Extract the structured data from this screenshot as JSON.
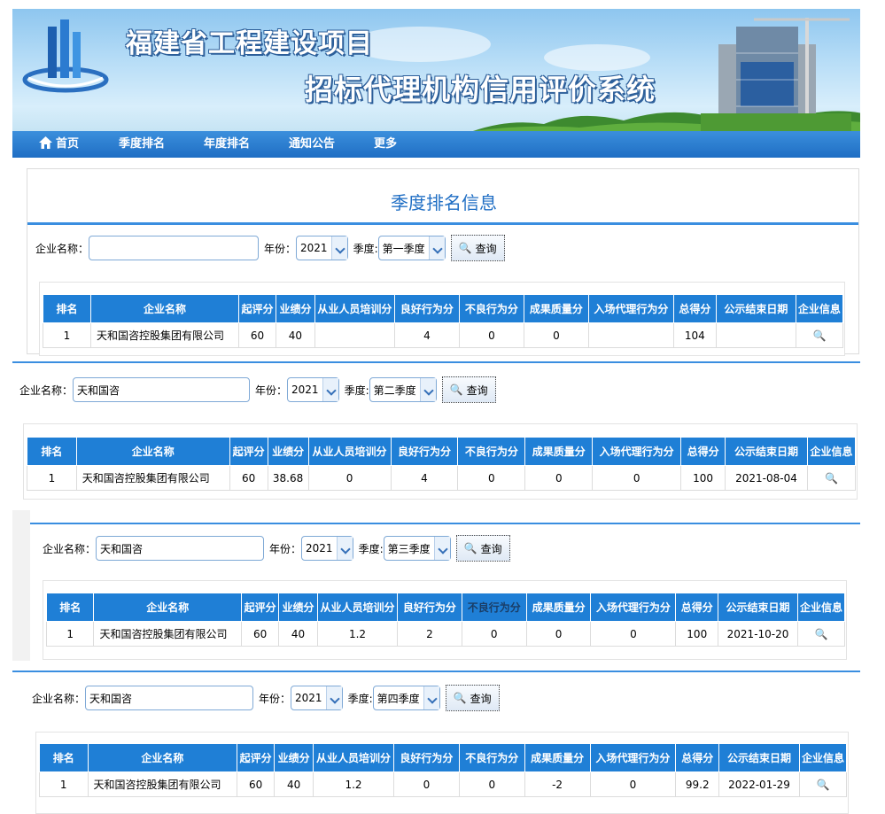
{
  "site": {
    "title_line1": "福建省工程建设项目",
    "title_line2": "招标代理机构信用评价系统"
  },
  "nav": {
    "items": [
      "首页",
      "季度排名",
      "年度排名",
      "通知公告",
      "更多"
    ]
  },
  "page": {
    "title": "季度排名信息"
  },
  "search_labels": {
    "name": "企业名称：",
    "year": "年份：",
    "quarter": "季度:",
    "query_button": "查询"
  },
  "table_headers": [
    "排名",
    "企业名称",
    "起评分",
    "业绩分",
    "从业人员培训分",
    "良好行为分",
    "不良行为分",
    "成果质量分",
    "入场代理行为分",
    "总得分",
    "公示结束日期",
    "企业信息"
  ],
  "queries": [
    {
      "name_value": "",
      "year": "2021",
      "quarter": "第一季度",
      "row": [
        "1",
        "天和国咨控股集团有限公司",
        "60",
        "40",
        "",
        "4",
        "0",
        "0",
        "",
        "104",
        ""
      ]
    },
    {
      "name_value": "天和国咨",
      "year": "2021",
      "quarter": "第二季度",
      "row": [
        "1",
        "天和国咨控股集团有限公司",
        "60",
        "38.68",
        "0",
        "4",
        "0",
        "0",
        "0",
        "100",
        "2021-08-04"
      ]
    },
    {
      "name_value": "天和国咨",
      "year": "2021",
      "quarter": "第三季度",
      "row": [
        "1",
        "天和国咨控股集团有限公司",
        "60",
        "40",
        "1.2",
        "2",
        "0",
        "0",
        "0",
        "100",
        "2021-10-20"
      ]
    },
    {
      "name_value": "天和国咨",
      "year": "2021",
      "quarter": "第四季度",
      "row": [
        "1",
        "天和国咨控股集团有限公司",
        "60",
        "40",
        "1.2",
        "0",
        "0",
        "-2",
        "0",
        "99.2",
        "2022-01-29"
      ]
    }
  ],
  "icons": {
    "home": "home-icon",
    "search": "magnifier-icon",
    "company_info": "magnifier-icon"
  },
  "colors": {
    "nav_blue": "#1f6ec4",
    "header_blue": "#1f7fd6",
    "title_blue": "#1f6ec4"
  }
}
